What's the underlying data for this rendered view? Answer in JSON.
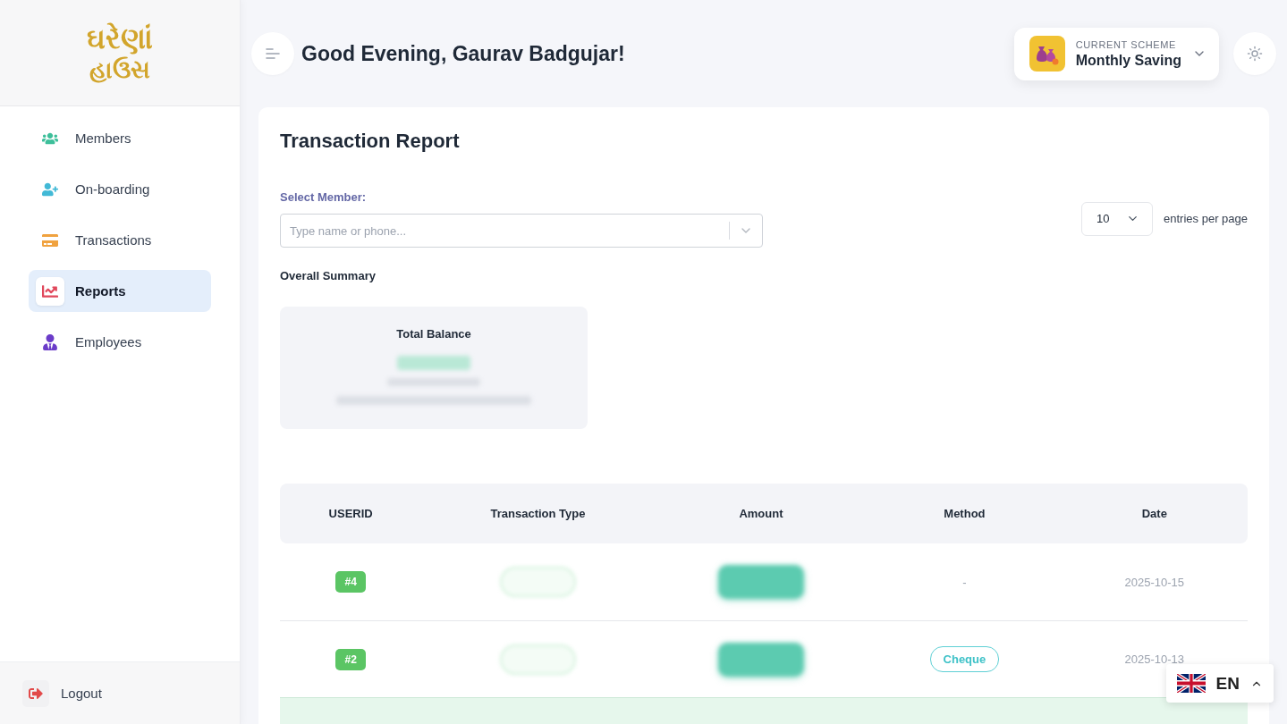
{
  "brand": {
    "line_1": "ઘરેણાં",
    "line_2": "હાઉસ"
  },
  "sidebar": {
    "items": [
      {
        "label": "Members",
        "selected": false
      },
      {
        "label": "On-boarding",
        "selected": false
      },
      {
        "label": "Transactions",
        "selected": false
      },
      {
        "label": "Reports",
        "selected": true
      },
      {
        "label": "Employees",
        "selected": false
      }
    ],
    "logout": "Logout"
  },
  "header": {
    "greeting": "Good Evening, Gaurav Badgujar!",
    "scheme": {
      "caption": "CURRENT SCHEME",
      "name": "Monthly Saving"
    }
  },
  "report": {
    "title": "Transaction Report",
    "member_select": {
      "label": "Select Member:",
      "placeholder": "Type name or phone..."
    },
    "page_size": {
      "value": "10",
      "label": "entries per page"
    },
    "summary": {
      "title": "Overall Summary",
      "cards": [
        {
          "title": "Total Balance"
        }
      ]
    },
    "table": {
      "columns": [
        "USERID",
        "Transaction Type",
        "Amount",
        "Method",
        "Date"
      ],
      "rows": [
        {
          "userid": "#4",
          "method": {
            "text": "-",
            "kind": "plain"
          },
          "date": "2025-10-15",
          "selected": false
        },
        {
          "userid": "#2",
          "method": {
            "text": "Cheque",
            "kind": "tag"
          },
          "date": "2025-10-13",
          "selected": false
        },
        {
          "selected": true
        }
      ]
    }
  },
  "language": {
    "code": "EN"
  }
}
